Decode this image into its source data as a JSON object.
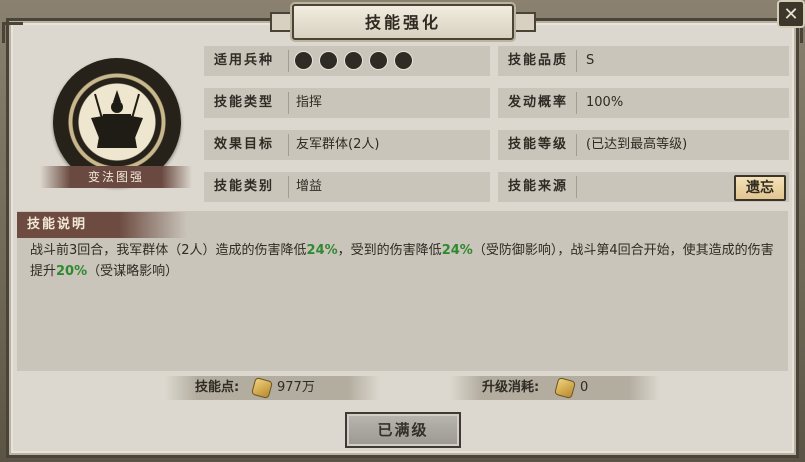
{
  "window": {
    "title": "技能强化",
    "close_glyph": "✕"
  },
  "skill": {
    "name": "变法图强",
    "emblem_icon": "warrior-silhouette-icon"
  },
  "fields": {
    "troop_type_label": "适用兵种",
    "troop_icons": [
      "cavalry-icon",
      "shield-icon",
      "bow-icon",
      "spear-icon",
      "siege-icon"
    ],
    "quality_label": "技能品质",
    "quality_value": "S",
    "skill_type_label": "技能类型",
    "skill_type_value": "指挥",
    "trigger_rate_label": "发动概率",
    "trigger_rate_value": "100%",
    "target_label": "效果目标",
    "target_value": "友军群体(2人)",
    "level_label": "技能等级",
    "level_value": "(已达到最高等级)",
    "category_label": "技能类别",
    "category_value": "增益",
    "source_label": "技能来源",
    "source_value": "",
    "forget_button": "遗忘"
  },
  "description": {
    "header": "技能说明",
    "seg1": "战斗前3回合，我军群体（2人）造成的伤害降低",
    "val1": "24%",
    "seg2": "，受到的伤害降低",
    "val2": "24%",
    "seg3": "（受防御影响），战斗第4回合开始，使其造成的伤害提升",
    "val3": "20%",
    "seg4": "（受谋略影响）"
  },
  "stats": {
    "points_label": "技能点:",
    "points_value": "977万",
    "cost_label": "升级消耗:",
    "cost_value": "0"
  },
  "actions": {
    "max_level_button": "已满级"
  },
  "colors": {
    "highlight": "#2f8a2f",
    "panel": "#dcd8cf",
    "header": "#6d4b41"
  }
}
